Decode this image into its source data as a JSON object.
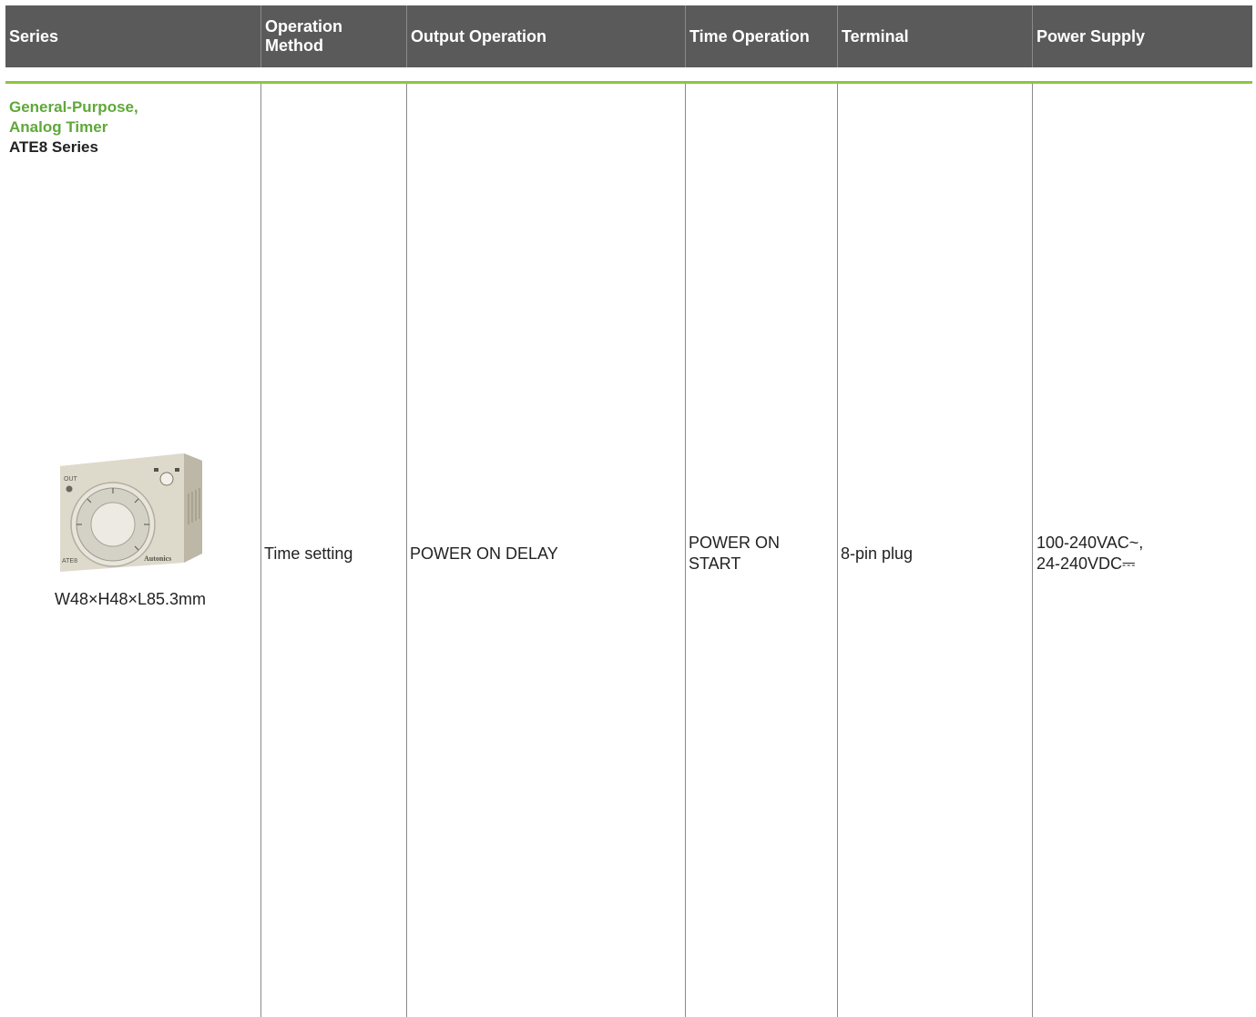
{
  "header": {
    "columns": [
      {
        "label": "Series"
      },
      {
        "label": "Operation\nMethod"
      },
      {
        "label": "Output Operation"
      },
      {
        "label": "Time Operation"
      },
      {
        "label": "Terminal"
      },
      {
        "label": "Power Supply"
      }
    ]
  },
  "row": {
    "series_line1": "General-Purpose,",
    "series_line2": "Analog Timer",
    "series_name": "ATE8 Series",
    "dimensions": "W48×H48×L85.3mm",
    "operation_method": "Time setting",
    "output_operation": "POWER ON DELAY",
    "time_operation_line1": "POWER ON",
    "time_operation_line2": "START",
    "terminal": "8-pin plug",
    "power_supply_line1": "100-240VAC~,",
    "power_supply_line2": "24-240VDC⎓"
  },
  "product_image": {
    "out_label": "OUT",
    "model_label": "ATE8",
    "brand_label": "Autonics"
  },
  "colors": {
    "header_bg": "#5a5a5a",
    "accent_green": "#8cc63f",
    "title_green": "#5fa83a"
  }
}
